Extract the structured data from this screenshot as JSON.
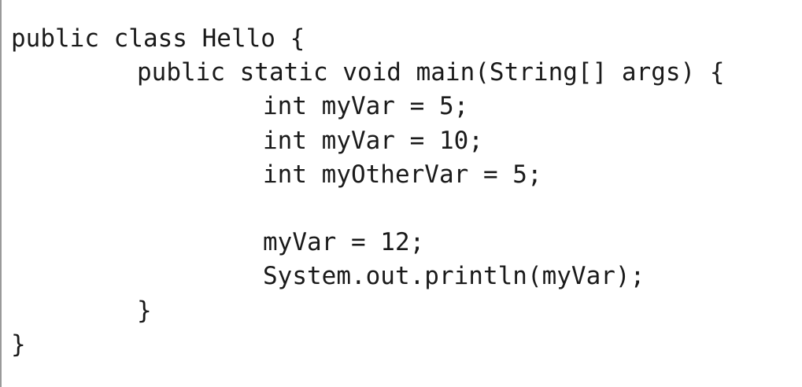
{
  "code": {
    "lines": [
      "public class Hello {",
      "public static void main(String[] args) {",
      "int myVar = 5;",
      "int myVar = 10;",
      "int myOtherVar = 5;",
      "",
      "myVar = 12;",
      "System.out.println(myVar);",
      "}",
      "}"
    ]
  }
}
